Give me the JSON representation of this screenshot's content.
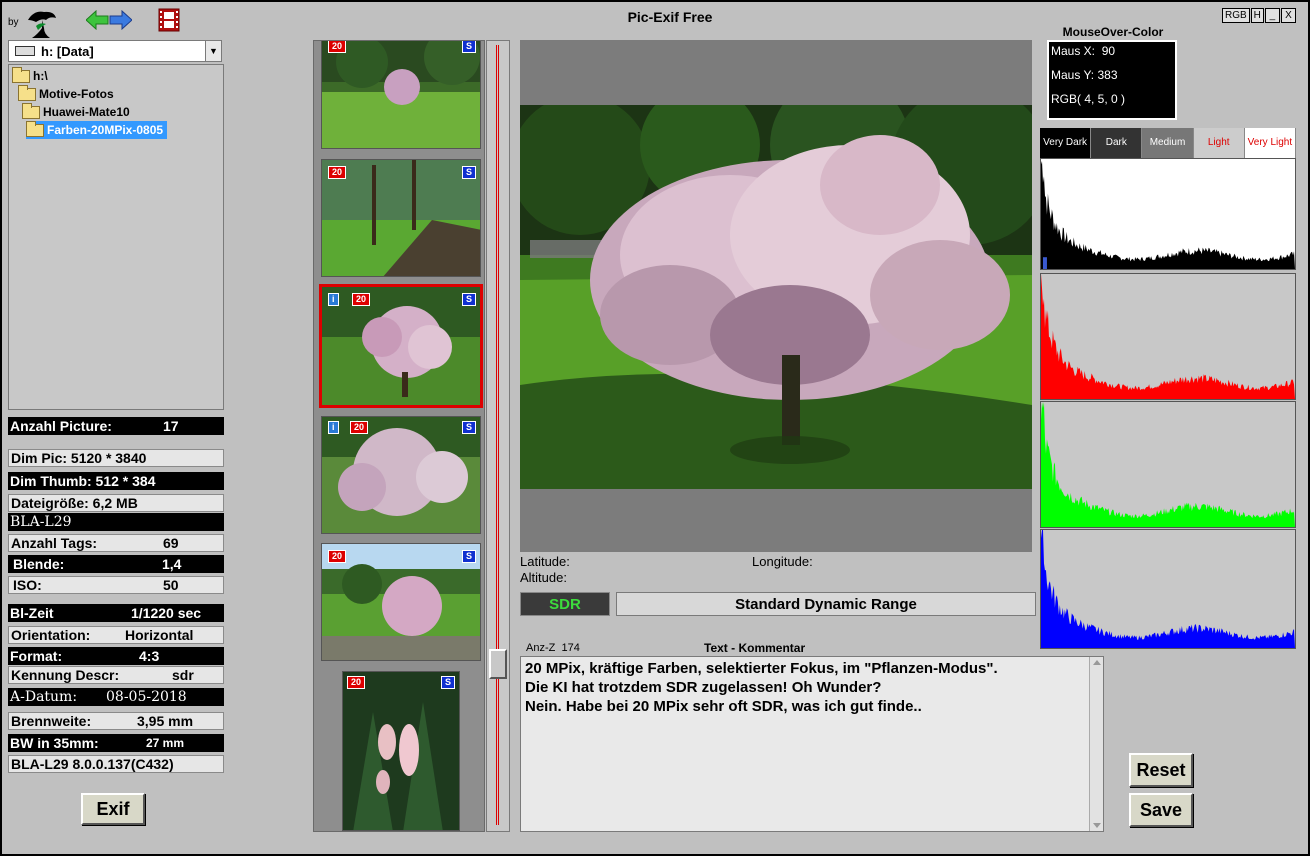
{
  "app": {
    "by_label": "by",
    "title": "Pic-Exif Free",
    "window_buttons": [
      "RGB",
      "H",
      "_",
      "X"
    ]
  },
  "folder": {
    "drive": "h: [Data]",
    "tree": [
      "h:\\",
      "Motive-Fotos",
      "Huawei-Mate10",
      "Farben-20MPix-0805"
    ]
  },
  "info": {
    "anzahl_picture_label": "Anzahl Picture:",
    "anzahl_picture_value": "17",
    "dim_pic": "Dim Pic: 5120 * 3840",
    "dim_thumb": "Dim Thumb: 512 * 384",
    "dateigroesse": "Dateigröße: 6,2 MB",
    "model": "BLA-L29",
    "anzahl_tags_label": "Anzahl Tags:",
    "anzahl_tags_value": "69",
    "blende_label": "Blende:",
    "blende_value": "1,4",
    "iso_label": "ISO:",
    "iso_value": "50",
    "blzeit_label": "Bl-Zeit",
    "blzeit_value": "1/1220 sec",
    "orientation_label": "Orientation:",
    "orientation_value": "Horizontal",
    "format_label": "Format:",
    "format_value": "4:3",
    "kennung_label": "Kennung Descr:",
    "kennung_value": "sdr",
    "adatum_label": "A-Datum:",
    "adatum_value": "08-05-2018",
    "brennweite_label": "Brennweite:",
    "brennweite_value": "3,95 mm",
    "bw35_label": "BW in 35mm:",
    "bw35_value": "27 mm",
    "firmware": "BLA-L29 8.0.0.137(C432)"
  },
  "buttons": {
    "exif": "Exif",
    "reset": "Reset",
    "save": "Save"
  },
  "thumbnails": [
    {
      "badges": [
        "20",
        "S"
      ],
      "selected": false
    },
    {
      "badges": [
        "20",
        "S"
      ],
      "selected": false
    },
    {
      "badges": [
        "i",
        "20",
        "S"
      ],
      "selected": true
    },
    {
      "badges": [
        "i",
        "20",
        "S"
      ],
      "selected": false
    },
    {
      "badges": [
        "20",
        "S"
      ],
      "selected": false
    },
    {
      "badges": [
        "20",
        "S"
      ],
      "selected": false
    }
  ],
  "geo": {
    "latitude": "Latitude:",
    "longitude": "Longitude:",
    "altitude": "Altitude:"
  },
  "dynamic_range": {
    "badge": "SDR",
    "description": "Standard Dynamic Range"
  },
  "comment": {
    "count_label": "Anz-Z",
    "count_value": "174",
    "title": "Text - Kommentar",
    "lines": [
      "20 MPix, kräftige Farben, selektierter Fokus, im \"Pflanzen-Modus\".",
      "Die KI hat trotzdem SDR zugelassen! Oh Wunder?",
      "Nein. Habe bei 20 MPix sehr oft SDR, was ich gut finde.."
    ]
  },
  "mouseover": {
    "title": "MouseOver-Color",
    "x_label": "Maus X:",
    "x_value": "90",
    "y_label": "Maus Y:",
    "y_value": "383",
    "rgb": "RGB(  4, 5, 0 )"
  },
  "histogram": {
    "brightness_labels": [
      "Very Dark",
      "Dark",
      "Medium",
      "Light",
      "Very Light"
    ],
    "channels": [
      {
        "name": "luminance",
        "color": "#000000",
        "bg": "#ffffff"
      },
      {
        "name": "red",
        "color": "#ff0000",
        "bg": "#c8c8c8"
      },
      {
        "name": "green",
        "color": "#00ff00",
        "bg": "#c8c8c8"
      },
      {
        "name": "blue",
        "color": "#0000ff",
        "bg": "#c8c8c8"
      }
    ]
  }
}
